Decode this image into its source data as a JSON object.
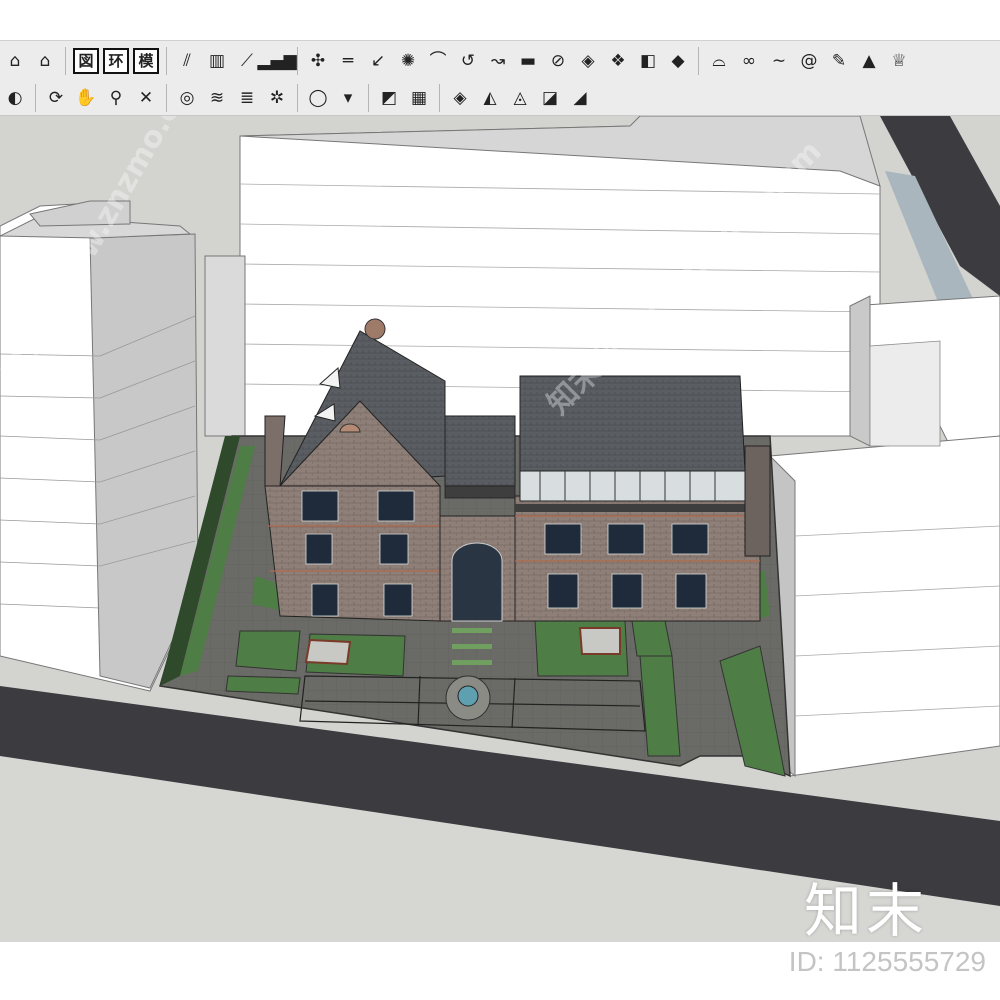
{
  "toolbar_row1": [
    {
      "id": "home",
      "icon": "home-icon",
      "glyph": "⌂"
    },
    {
      "id": "warehouse",
      "icon": "warehouse-icon",
      "glyph": "⌂"
    },
    {
      "id": "t_tu",
      "icon": "cjk-tu-icon",
      "label": "図"
    },
    {
      "id": "t_huan",
      "icon": "cjk-huan-icon",
      "label": "环"
    },
    {
      "id": "t_mo",
      "icon": "cjk-mo-icon",
      "label": "模"
    },
    {
      "id": "stairs",
      "icon": "stairs-icon",
      "glyph": "⫽"
    },
    {
      "id": "pillar",
      "icon": "column-icon",
      "glyph": "▥"
    },
    {
      "id": "ramp",
      "icon": "ramp-icon",
      "glyph": "⟋"
    },
    {
      "id": "bars",
      "icon": "bar-chart-icon",
      "glyph": "▂▄▆"
    },
    {
      "id": "axis",
      "icon": "axis-icon",
      "glyph": "✣"
    },
    {
      "id": "offset",
      "icon": "offset-lines-icon",
      "glyph": "═"
    },
    {
      "id": "arrow-bend",
      "icon": "bend-arrow-icon",
      "glyph": "↙"
    },
    {
      "id": "explode",
      "icon": "explode-icon",
      "glyph": "✺"
    },
    {
      "id": "arch",
      "icon": "arch-icon",
      "glyph": "⌒"
    },
    {
      "id": "rotate",
      "icon": "rotate-icon",
      "glyph": "↺"
    },
    {
      "id": "curve-tool",
      "icon": "curve-tool-icon",
      "glyph": "↝"
    },
    {
      "id": "slab",
      "icon": "slab-icon",
      "glyph": "▬"
    },
    {
      "id": "node",
      "icon": "node-icon",
      "glyph": "⊘"
    },
    {
      "id": "grid-a",
      "icon": "grid-plane-icon",
      "glyph": "◈"
    },
    {
      "id": "grid-b",
      "icon": "grid-move-icon",
      "glyph": "❖"
    },
    {
      "id": "block",
      "icon": "block-icon",
      "glyph": "◧"
    },
    {
      "id": "roof",
      "icon": "roof-icon",
      "glyph": "◆"
    },
    {
      "id": "arc-cap",
      "icon": "arc-cap-icon",
      "glyph": "⌓"
    },
    {
      "id": "chain",
      "icon": "chain-icon",
      "glyph": "∞"
    },
    {
      "id": "wave",
      "icon": "wave-icon",
      "glyph": "∼"
    },
    {
      "id": "spiral",
      "icon": "spiral-icon",
      "glyph": "@"
    },
    {
      "id": "pen",
      "icon": "pencil-icon",
      "glyph": "✎"
    },
    {
      "id": "terrain",
      "icon": "terrain-icon",
      "glyph": "▲"
    },
    {
      "id": "crown",
      "icon": "crown-icon",
      "glyph": "♕"
    }
  ],
  "toolbar_row2": [
    {
      "id": "paint",
      "icon": "paint-bucket-icon",
      "glyph": "◐"
    },
    {
      "id": "orbit",
      "icon": "orbit-icon",
      "glyph": "⟳"
    },
    {
      "id": "pan",
      "icon": "pan-hand-icon",
      "glyph": "✋"
    },
    {
      "id": "zoom",
      "icon": "zoom-icon",
      "glyph": "⚲"
    },
    {
      "id": "zoom-extents",
      "icon": "zoom-extents-icon",
      "glyph": "✕"
    },
    {
      "id": "sandbox-a",
      "icon": "sandbox-contour-icon",
      "glyph": "◎"
    },
    {
      "id": "sandbox-b",
      "icon": "sandbox-scratch-icon",
      "glyph": "≋"
    },
    {
      "id": "sandbox-c",
      "icon": "sandbox-stamp-icon",
      "glyph": "≣"
    },
    {
      "id": "sandbox-d",
      "icon": "sandbox-drape-icon",
      "glyph": "✲"
    },
    {
      "id": "user",
      "icon": "user-dropdown-icon",
      "glyph": "◯"
    },
    {
      "id": "caret",
      "icon": "chevron-down-icon",
      "glyph": "▾"
    },
    {
      "id": "face-a",
      "icon": "texture-face-icon",
      "glyph": "◩"
    },
    {
      "id": "face-b",
      "icon": "texture-grid-icon",
      "glyph": "▦"
    },
    {
      "id": "solid-a",
      "icon": "solid-union-icon",
      "glyph": "◈"
    },
    {
      "id": "solid-b",
      "icon": "solid-intersect-icon",
      "glyph": "◭"
    },
    {
      "id": "solid-c",
      "icon": "solid-subtract-icon",
      "glyph": "◬"
    },
    {
      "id": "solid-d",
      "icon": "solid-trim-icon",
      "glyph": "◪"
    },
    {
      "id": "solid-e",
      "icon": "solid-split-icon",
      "glyph": "◢"
    }
  ],
  "watermark": {
    "logo": "知末",
    "id_text": "ID: 1125555729",
    "diagonal": [
      "知末网www.znzmo.com",
      "知末网www.znzmo.com"
    ]
  },
  "colors": {
    "road": "#3a3a3e",
    "ground": "#d2d2d0",
    "lawn": "#4e7b47",
    "roof": "#55595f",
    "brick": "#8f7f76",
    "block_light": "#ffffff",
    "block_side": "#cfcfcf"
  }
}
